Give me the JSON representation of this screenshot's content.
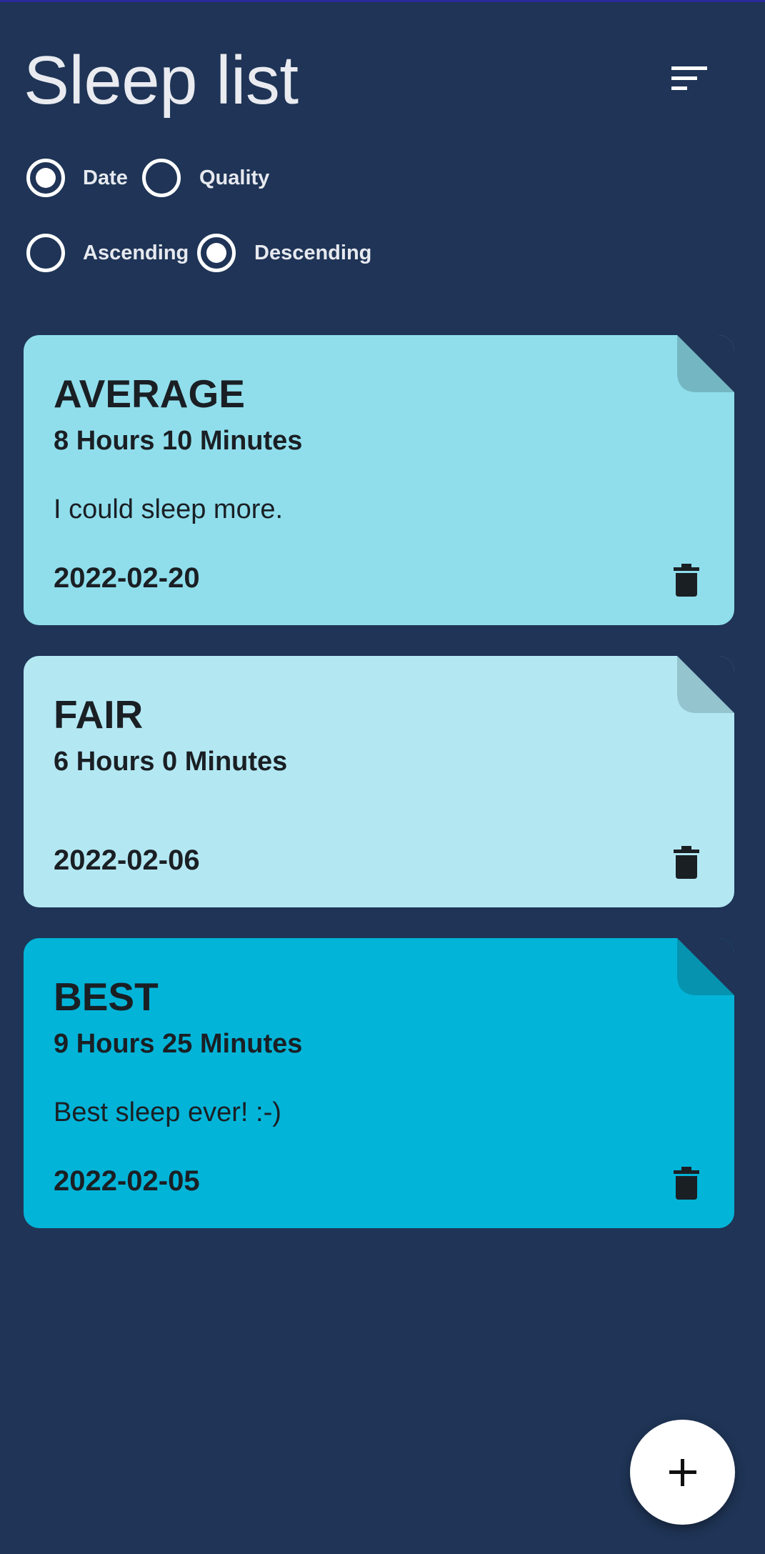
{
  "header": {
    "title": "Sleep list",
    "sort_icon": "sort-lines-icon"
  },
  "sort_options": {
    "field": {
      "selected": "Date",
      "options": [
        {
          "label": "Date",
          "checked": true
        },
        {
          "label": "Quality",
          "checked": false
        }
      ]
    },
    "order": {
      "selected": "Descending",
      "options": [
        {
          "label": "Ascending",
          "checked": false
        },
        {
          "label": "Descending",
          "checked": true
        }
      ]
    }
  },
  "entries": [
    {
      "quality": "AVERAGE",
      "duration": "8 Hours 10 Minutes",
      "note": "I could sleep more.",
      "date": "2022-02-20",
      "color": "#90deec",
      "fold_color": "#74b7c3"
    },
    {
      "quality": "FAIR",
      "duration": "6 Hours 0 Minutes",
      "note": "",
      "date": "2022-02-06",
      "color": "#b3e8f3",
      "fold_color": "#94c4ce"
    },
    {
      "quality": "BEST",
      "duration": "9 Hours 25 Minutes",
      "note": "Best sleep ever! :-)",
      "date": "2022-02-05",
      "color": "#02b4d8",
      "fold_color": "#0593b0"
    }
  ],
  "fab": {
    "icon": "plus-icon"
  },
  "colors": {
    "background": "#1f3456",
    "title": "#e9ebf0",
    "radio": "#ffffff",
    "fab": "#ffffff"
  }
}
